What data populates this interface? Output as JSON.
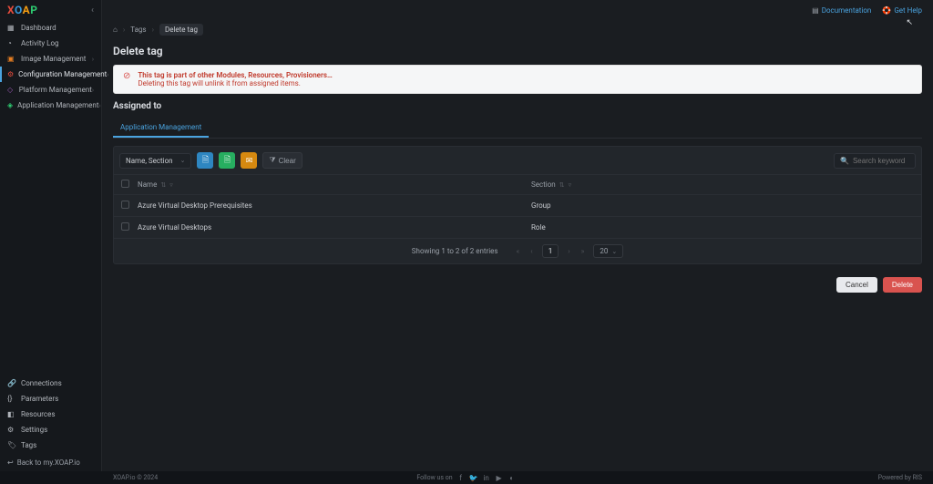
{
  "brand": {
    "x": "X",
    "o": "O",
    "a": "A",
    "p": "P"
  },
  "sidebar": {
    "top": [
      {
        "icon": "▦",
        "label": "Dashboard",
        "expandable": false
      },
      {
        "icon": "◔",
        "label": "Activity Log",
        "expandable": false
      },
      {
        "icon": "▣",
        "label": "Image Management",
        "expandable": true,
        "cls": "img-mgmt"
      },
      {
        "icon": "⚙",
        "label": "Configuration Management",
        "expandable": true,
        "cls": "cfg-mgmt",
        "active": true
      },
      {
        "icon": "◇",
        "label": "Platform Management",
        "expandable": true,
        "cls": "plat-mgmt"
      },
      {
        "icon": "◈",
        "label": "Application Management",
        "expandable": true,
        "cls": "app-mgmt"
      }
    ],
    "bottom": [
      {
        "icon": "🔗",
        "label": "Connections"
      },
      {
        "icon": "{}",
        "label": "Parameters"
      },
      {
        "icon": "◧",
        "label": "Resources"
      },
      {
        "icon": "⚙",
        "label": "Settings"
      },
      {
        "icon": "🏷",
        "label": "Tags"
      }
    ],
    "back": {
      "icon": "↩",
      "label": "Back to my.XOAP.io"
    }
  },
  "topbar": {
    "doc": "Documentation",
    "help": "Get Help"
  },
  "breadcrumb": {
    "home_icon": "⌂",
    "items": [
      "Tags"
    ],
    "current": "Delete tag"
  },
  "page": {
    "title": "Delete tag",
    "warning_title": "This tag is part of other Modules, Resources, Provisioners…",
    "warning_sub": "Deleting this tag will unlink it from assigned items.",
    "section_title": "Assigned to"
  },
  "tabs": [
    "Application Management"
  ],
  "toolbar": {
    "filter_label": "Name, Section",
    "clear_label": "Clear",
    "search_placeholder": "Search keyword"
  },
  "table": {
    "headers": {
      "name": "Name",
      "section": "Section"
    },
    "rows": [
      {
        "name": "Azure Virtual Desktop Prerequisites",
        "section": "Group"
      },
      {
        "name": "Azure Virtual Desktops",
        "section": "Role"
      }
    ]
  },
  "pager": {
    "info": "Showing 1 to 2 of 2 entries",
    "current": "1",
    "size": "20"
  },
  "actions": {
    "cancel": "Cancel",
    "delete": "Delete"
  },
  "footer": {
    "left": "XOAP.io © 2024",
    "follow": "Follow us on",
    "right": "Powered by RIS"
  }
}
